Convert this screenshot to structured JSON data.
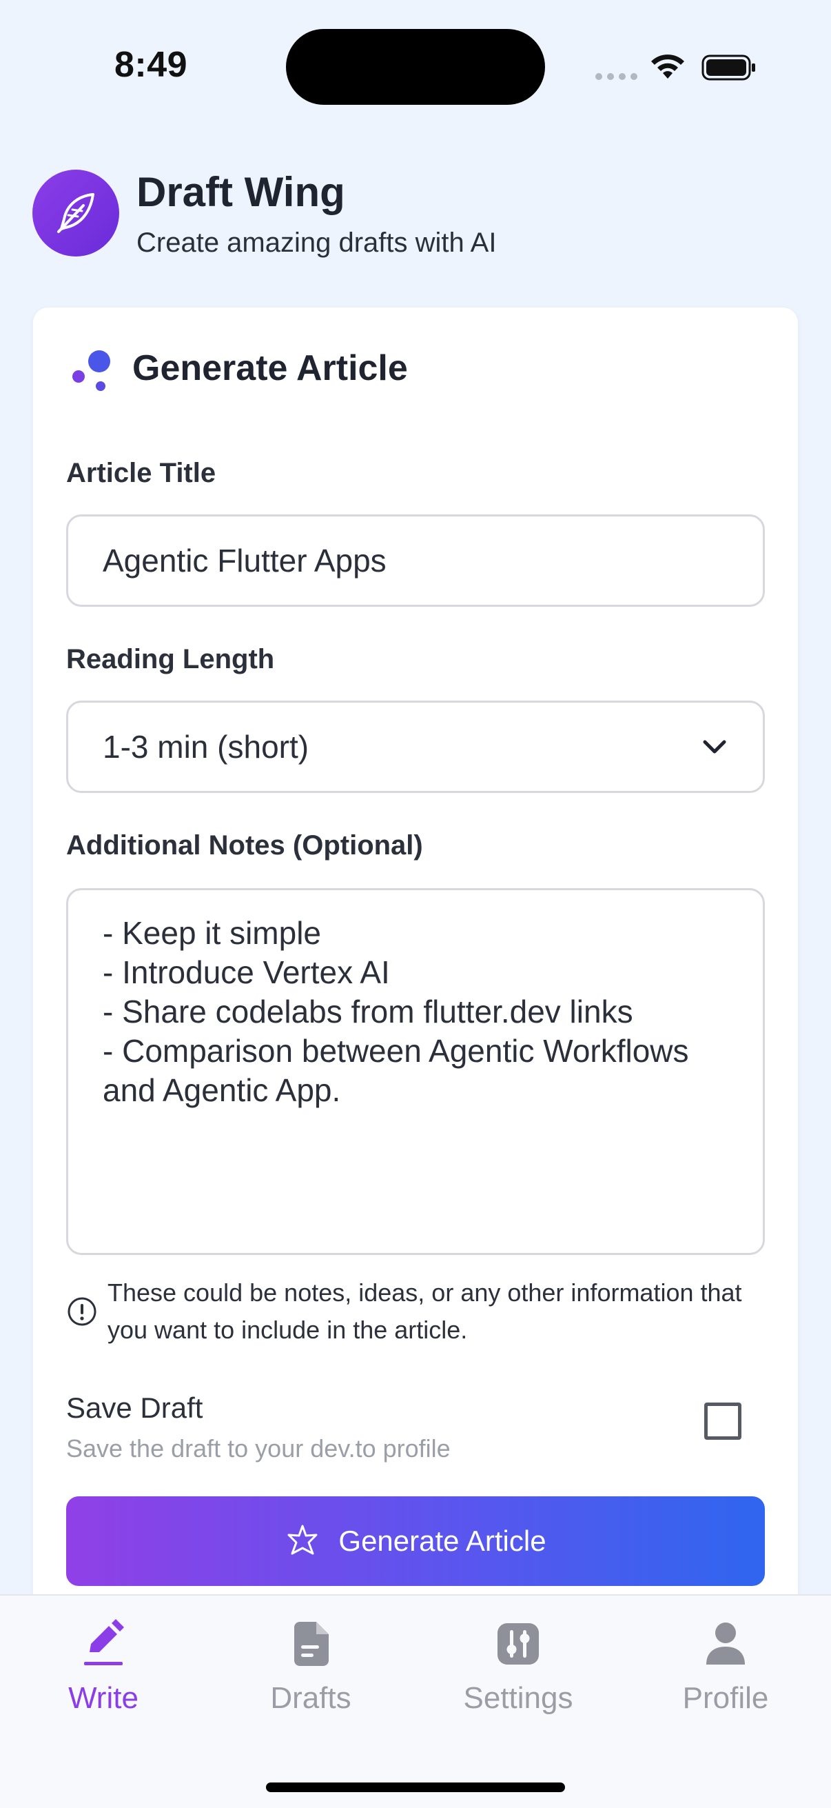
{
  "status_bar": {
    "time": "8:49"
  },
  "header": {
    "title": "Draft Wing",
    "subtitle": "Create amazing drafts with AI",
    "logo_icon": "feather-icon"
  },
  "card": {
    "title": "Generate Article",
    "title_icon": "bubbles-icon",
    "article_title": {
      "label": "Article Title",
      "value": "Agentic Flutter Apps"
    },
    "reading_length": {
      "label": "Reading Length",
      "selected": "1-3 min (short)"
    },
    "notes": {
      "label": "Additional Notes (Optional)",
      "value": "- Keep it simple\n- Introduce Vertex AI\n- Share codelabs from flutter.dev links\n- Comparison between Agentic Workflows and Agentic App.",
      "hint": "These could be notes, ideas, or any other information that you want to include in the article."
    },
    "save_draft": {
      "label": "Save Draft",
      "description": "Save the draft to your dev.to profile",
      "checked": false
    },
    "generate_button": {
      "label": "Generate Article"
    }
  },
  "bottom_nav": {
    "items": [
      {
        "label": "Write",
        "icon": "pencil-icon",
        "active": true
      },
      {
        "label": "Drafts",
        "icon": "document-icon",
        "active": false
      },
      {
        "label": "Settings",
        "icon": "sliders-icon",
        "active": false
      },
      {
        "label": "Profile",
        "icon": "person-icon",
        "active": false
      }
    ]
  },
  "colors": {
    "accent": "#8b3ee8",
    "gradient_start": "#9040e6",
    "gradient_end": "#2f66ef",
    "background": "#eef4fe"
  }
}
